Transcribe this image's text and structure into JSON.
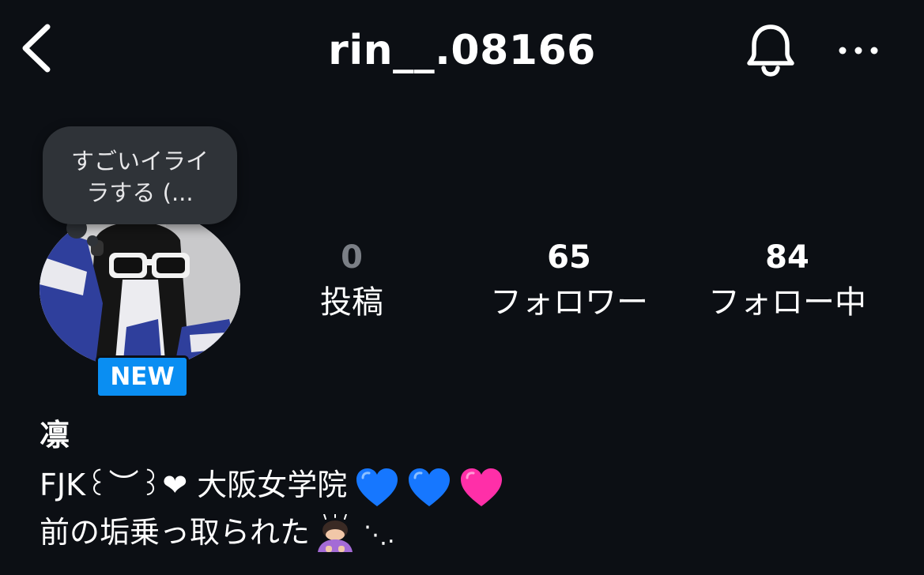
{
  "header": {
    "username": "rin__.08166"
  },
  "note": {
    "text": "すごいイライ\nラする (..."
  },
  "avatar": {
    "badge": "NEW"
  },
  "stats": {
    "posts": {
      "count": "0",
      "label": "投稿"
    },
    "followers": {
      "count": "65",
      "label": "フォロワー"
    },
    "following": {
      "count": "84",
      "label": "フォロー中"
    }
  },
  "bio": {
    "name": "凛",
    "line1_text": "FJK꒰︶꒱❤ 大阪女学院",
    "line2_text": "前の垢乗っ取られた",
    "line2_suffix": "⋱."
  },
  "colors": {
    "background": "#0c0f14",
    "badge": "#0a8ef2",
    "note_bubble": "#2f3338",
    "heart_blue": "#1677ff",
    "heart_pink": "#ff2fa8",
    "muted_count": "#7b7f86"
  },
  "icons": [
    "chevron-left-icon",
    "bell-icon",
    "more-icon",
    "blue-heart-icon",
    "pink-heart-icon",
    "person-bowing-icon"
  ]
}
